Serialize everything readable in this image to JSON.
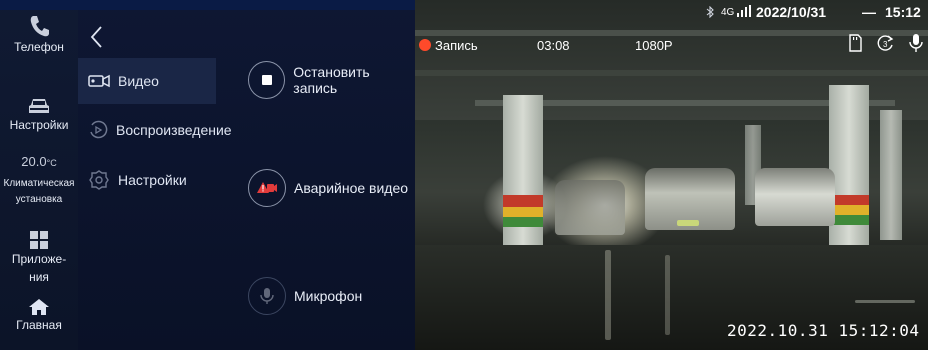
{
  "status_bar": {
    "date": "2022/10/31",
    "time": "15:12",
    "network": "4G"
  },
  "sidebar": {
    "items": [
      {
        "label": "Телефон",
        "icon": "phone-icon"
      },
      {
        "label": "Настройки",
        "icon": "car-icon"
      },
      {
        "label": "20.0°C",
        "icon": ""
      },
      {
        "label": "Климатическая установка",
        "icon": ""
      },
      {
        "label": "Приложе-ния",
        "icon": "apps-icon"
      },
      {
        "label": "Главная",
        "icon": "home-icon"
      }
    ],
    "climate_temp": "20.0",
    "climate_unit": "°C",
    "climate_label_1": "Климатическая",
    "climate_label_2": "установка",
    "apps_label_1": "Приложе-",
    "apps_label_2": "ния"
  },
  "menu": {
    "items": [
      {
        "label": "Видео",
        "icon": "video-camera-icon",
        "selected": true
      },
      {
        "label": "Воспроизведение",
        "icon": "playback-icon",
        "selected": false
      },
      {
        "label": "Настройки",
        "icon": "settings-gear-icon",
        "selected": false
      }
    ]
  },
  "actions": {
    "stop": "Остановить запись",
    "emergency": "Аварийное видео",
    "mic": "Микрофон"
  },
  "camera": {
    "rec_label": "Запись",
    "elapsed": "03:08",
    "resolution": "1080P",
    "plate": "",
    "timestamp": "2022.10.31 15:12:04",
    "rec_color": "#ff4a2a"
  },
  "colors": {
    "panel_bg": "#0e1733",
    "selected_bg": "#1a2646",
    "accent_blue": "#2a6fd6"
  }
}
